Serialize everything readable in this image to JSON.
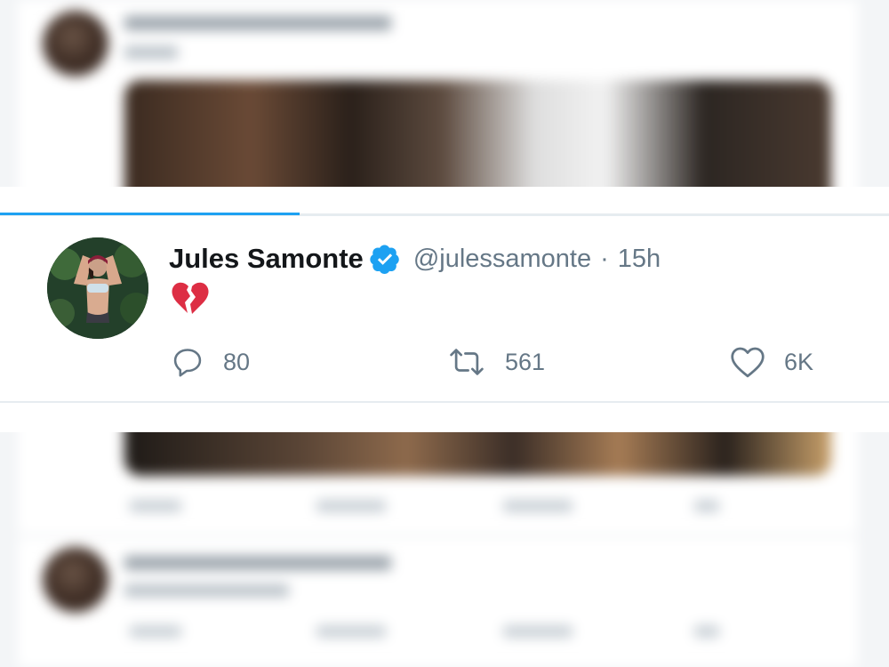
{
  "tweet": {
    "display_name": "Jules Samonte",
    "verified": true,
    "handle": "@julessamonte",
    "separator": "·",
    "time": "15h",
    "content_emoji": "broken-heart",
    "actions": {
      "replies": "80",
      "retweets": "561",
      "likes": "6K"
    }
  },
  "progress": {
    "fraction": 0.337
  },
  "icons": {
    "verified": "verified-badge-icon",
    "reply": "reply-icon",
    "retweet": "retweet-icon",
    "like": "heart-icon",
    "content": "broken-heart-icon"
  },
  "colors": {
    "accent": "#1da1f2",
    "name": "#14171a",
    "muted": "#657786",
    "broken_heart": "#dd2e44"
  }
}
